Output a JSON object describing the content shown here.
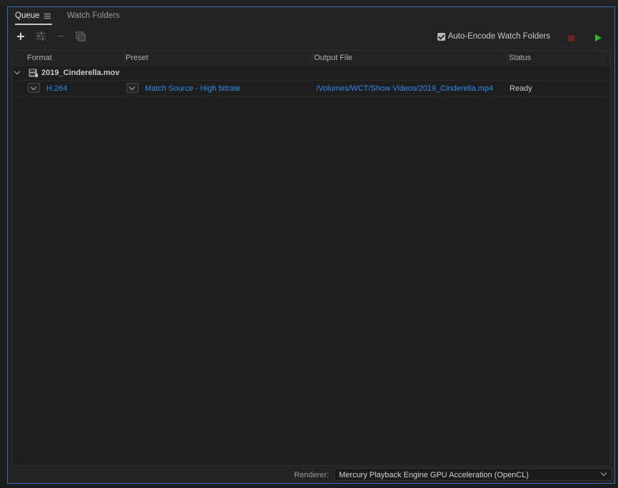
{
  "tabs": {
    "queue": "Queue",
    "watch_folders": "Watch Folders"
  },
  "toolbar": {
    "add_icon": "plus-icon",
    "settings_icon": "settings-icon",
    "remove_icon": "minus-icon",
    "duplicate_icon": "duplicate-icon",
    "auto_encode_label": "Auto-Encode Watch Folders",
    "auto_encode_checked": true,
    "stop_color": "#6b2424",
    "play_color": "#2fb52f"
  },
  "table": {
    "headers": {
      "format": "Format",
      "preset": "Preset",
      "output": "Output File",
      "status": "Status"
    },
    "source": {
      "name": "2019_Cinderella.mov",
      "outputs": [
        {
          "format": "H.264",
          "preset": "Match Source - High bitrate",
          "output_file": "/Volumes/WCT/Show Videos/2019_Cinderella.mp4",
          "status": "Ready"
        }
      ]
    }
  },
  "footer": {
    "renderer_label": "Renderer:",
    "renderer_value": "Mercury Playback Engine GPU Acceleration (OpenCL)"
  },
  "colors": {
    "accent_link": "#2d8ceb",
    "panel_border": "#3a6fb4",
    "background": "#232323"
  }
}
